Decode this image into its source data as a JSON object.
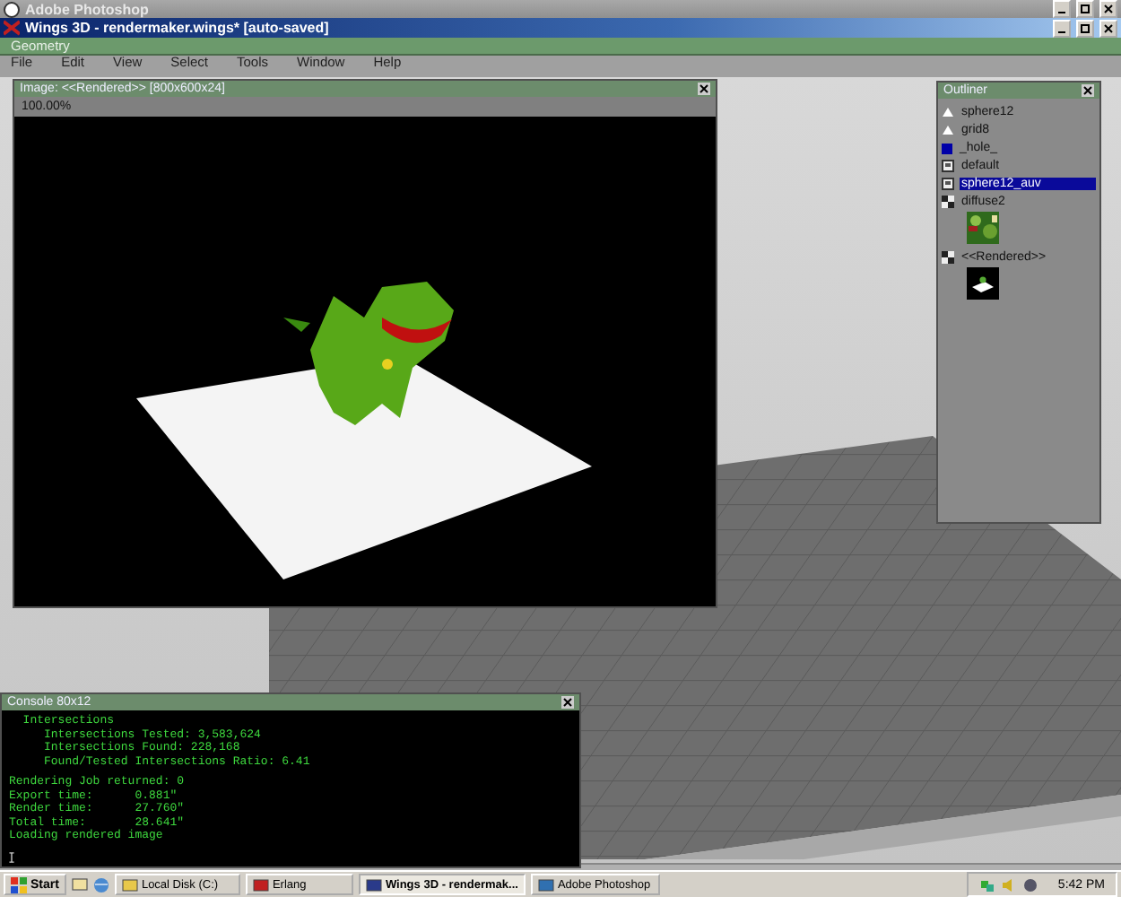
{
  "photoshop_window": {
    "title": "Adobe Photoshop"
  },
  "wings_window": {
    "title": "Wings 3D - rendermaker.wings* [auto-saved]",
    "mode_bar": "Geometry",
    "menu": [
      "File",
      "Edit",
      "View",
      "Select",
      "Tools",
      "Window",
      "Help"
    ]
  },
  "image_window": {
    "title": "Image: <<Rendered>> [800x600x24]",
    "zoom": "100.00%"
  },
  "outliner": {
    "title": "Outliner",
    "items": [
      {
        "kind": "object",
        "label": "sphere12",
        "selected": false
      },
      {
        "kind": "object",
        "label": "grid8",
        "selected": false
      },
      {
        "kind": "swatch",
        "label": "_hole_",
        "color": "#0000a8",
        "selected": false
      },
      {
        "kind": "material",
        "label": "default",
        "selected": false
      },
      {
        "kind": "material",
        "label": "sphere12_auv",
        "selected": true
      },
      {
        "kind": "texture",
        "label": "diffuse2",
        "selected": false
      },
      {
        "kind": "render",
        "label": "<<Rendered>>",
        "selected": false
      }
    ]
  },
  "console": {
    "title": "Console 80x12",
    "blocks": [
      [
        "  Intersections",
        "     Intersections Tested: 3,583,624",
        "     Intersections Found: 228,168",
        "     Found/Tested Intersections Ratio: 6.41"
      ],
      [
        "Rendering Job returned: 0",
        "Export time:      0.881\"",
        "Render time:      27.760\"",
        "Total time:       28.641\"",
        "Loading rendered image"
      ]
    ]
  },
  "taskbar": {
    "start": "Start",
    "tasks": [
      {
        "label": "Local Disk (C:)",
        "kind": "folder",
        "selected": false
      },
      {
        "label": "Erlang",
        "kind": "erlang",
        "selected": false
      },
      {
        "label": "Wings 3D - rendermak...",
        "kind": "wings",
        "selected": true
      },
      {
        "label": "Adobe Photoshop",
        "kind": "photoshop",
        "selected": false
      }
    ],
    "clock": "5:42 PM"
  }
}
